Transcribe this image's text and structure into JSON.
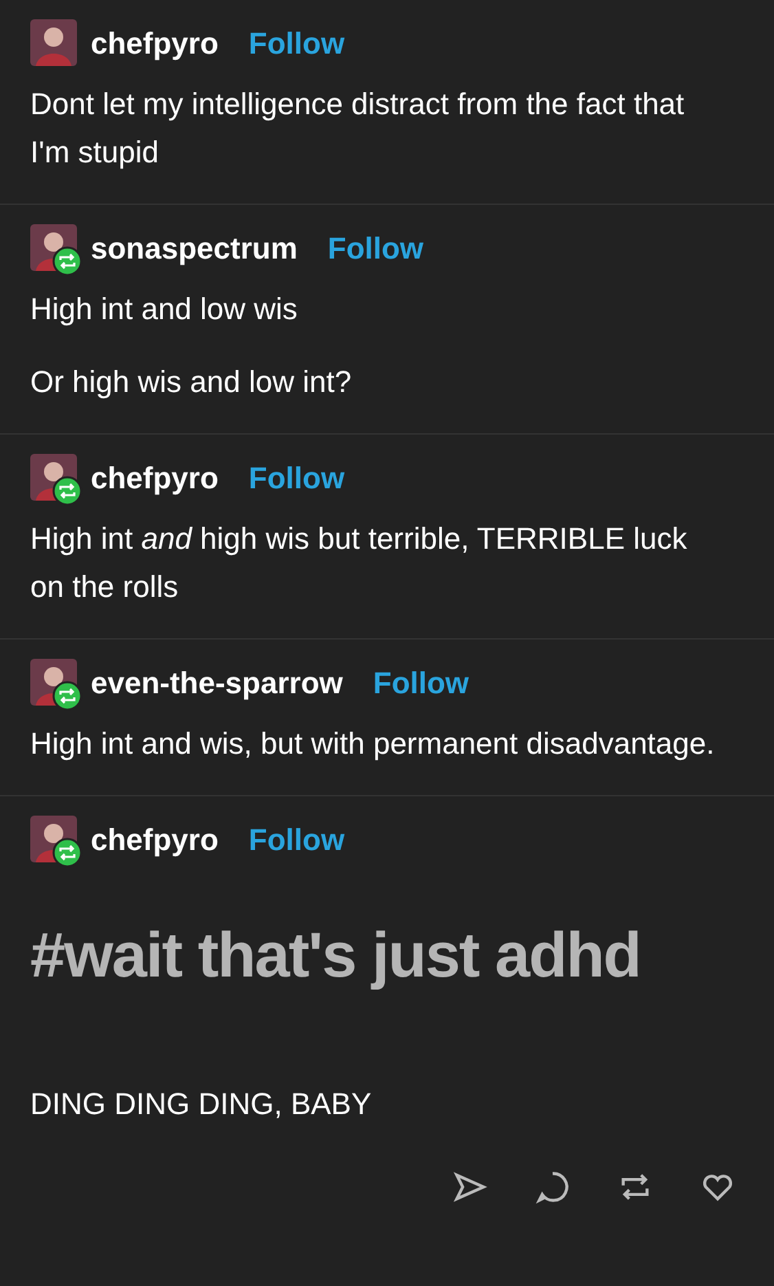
{
  "posts": [
    {
      "username": "chefpyro",
      "follow": "Follow",
      "reblogged": false,
      "body": [
        {
          "kind": "text",
          "text": "Dont let my intelligence distract from the fact that I'm stupid"
        }
      ]
    },
    {
      "username": "sonaspectrum",
      "follow": "Follow",
      "reblogged": true,
      "body": [
        {
          "kind": "text",
          "text": "High int and low wis"
        },
        {
          "kind": "text",
          "text": "Or high wis and low int?"
        }
      ]
    },
    {
      "username": "chefpyro",
      "follow": "Follow",
      "reblogged": true,
      "body": [
        {
          "kind": "text",
          "text": "High int *and* high wis but terrible, TERRIBLE luck on the rolls"
        }
      ]
    },
    {
      "username": "even-the-sparrow",
      "follow": "Follow",
      "reblogged": true,
      "body": [
        {
          "kind": "text",
          "text": "High int and wis, but with permanent disadvantage."
        }
      ]
    },
    {
      "username": "chefpyro",
      "follow": "Follow",
      "reblogged": true,
      "body": [
        {
          "kind": "big",
          "text": "#wait that's just adhd"
        },
        {
          "kind": "text",
          "text": "DING DING DING, BABY"
        }
      ]
    }
  ]
}
